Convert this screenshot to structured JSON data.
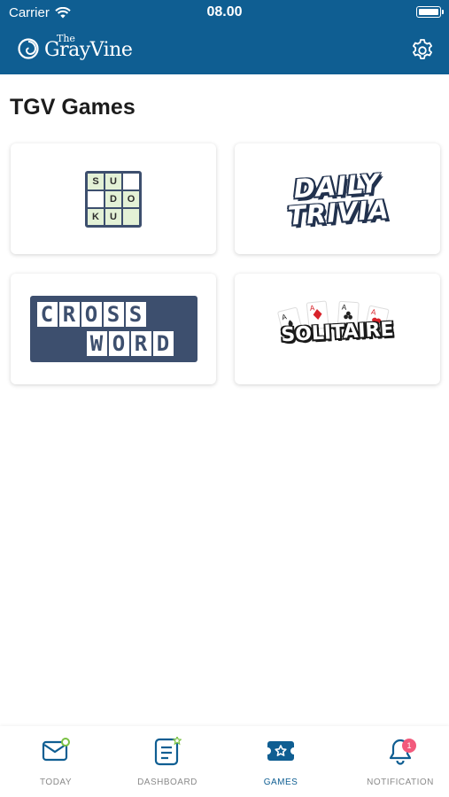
{
  "status_bar": {
    "carrier": "Carrier",
    "time": "08.00"
  },
  "header": {
    "logo_the": "The",
    "logo_name": "GrayVine",
    "settings_icon": "gear-icon"
  },
  "page": {
    "title": "TGV Games"
  },
  "games": [
    {
      "name": "sudoku",
      "letters": [
        "S",
        "U",
        "",
        "",
        "D",
        "O",
        "K",
        "U",
        ""
      ]
    },
    {
      "name": "daily-trivia",
      "line1": "DAILY",
      "line2": "TRIVIA"
    },
    {
      "name": "crossword",
      "row1": [
        "C",
        "R",
        "O",
        "S",
        "S"
      ],
      "row2": [
        "W",
        "O",
        "R",
        "D"
      ]
    },
    {
      "name": "solitaire",
      "word": "SOLITAIRE"
    }
  ],
  "tab_bar": {
    "active": "GAMES",
    "tabs": [
      {
        "label": "TODAY",
        "icon": "mail-icon"
      },
      {
        "label": "DASHBOARD",
        "icon": "dashboard-icon"
      },
      {
        "label": "GAMES",
        "icon": "ticket-star-icon"
      },
      {
        "label": "NOTIFICATION",
        "icon": "bell-icon",
        "badge": "1"
      }
    ]
  },
  "colors": {
    "brand": "#0f5e92",
    "accent_green": "#7ac143",
    "badge": "#f25a7c",
    "game_navy": "#3d4f6e"
  }
}
